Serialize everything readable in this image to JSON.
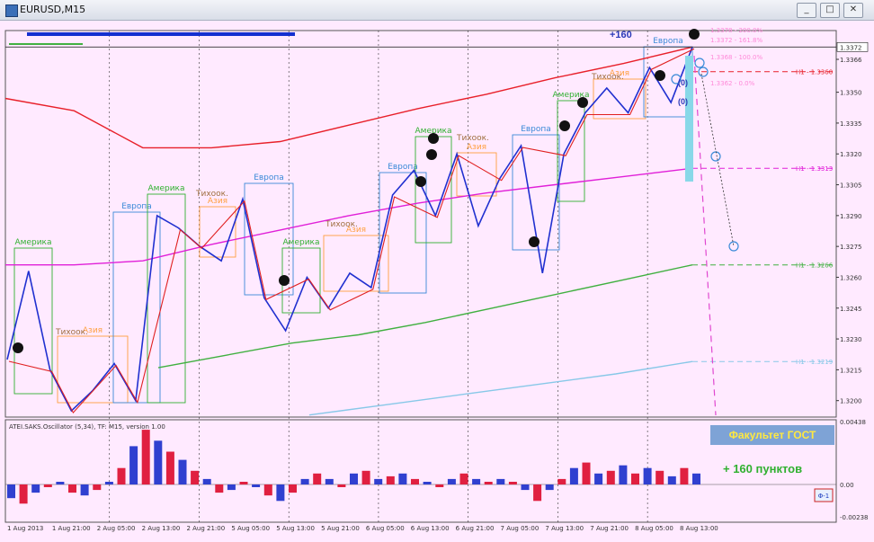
{
  "window": {
    "title": "EURUSD,M15",
    "buttons": [
      "_",
      "□",
      "✕"
    ]
  },
  "chart_data": {
    "type": "line",
    "symbol": "EURUSD",
    "timeframe": "M15",
    "price_axis": {
      "ticks": [
        "1.3366",
        "1.3350",
        "1.3335",
        "1.3320",
        "1.3305",
        "1.3290",
        "1.3275",
        "1.3260",
        "1.3245",
        "1.3230",
        "1.3215",
        "1.3200"
      ],
      "current_price": "1.3372",
      "ylim": [
        1.3192,
        1.338
      ]
    },
    "time_axis": {
      "ticks": [
        "1 Aug 2013",
        "1 Aug 21:00",
        "2 Aug 05:00",
        "2 Aug 13:00",
        "2 Aug 21:00",
        "5 Aug 05:00",
        "5 Aug 13:00",
        "5 Aug 21:00",
        "6 Aug 05:00",
        "6 Aug 13:00",
        "6 Aug 21:00",
        "7 Aug 05:00",
        "7 Aug 13:00",
        "7 Aug 21:00",
        "8 Aug 05:00",
        "8 Aug 13:00"
      ]
    },
    "series": [
      {
        "name": "",
        "color": "#e8202a",
        "values": [
          1.3347,
          1.3341,
          1.3323,
          1.3323,
          1.3326,
          1.3334,
          1.3342,
          1.3349,
          1.3357,
          1.3364,
          1.3372
        ]
      },
      {
        "name": "",
        "color": "#e020d8",
        "values": [
          1.3266,
          1.3266,
          1.3268,
          1.3276,
          1.3283,
          1.329,
          1.3296,
          1.3301,
          1.3305,
          1.3309,
          1.3313
        ]
      },
      {
        "name": "",
        "color": "#40b040",
        "values": [
          1.3216,
          1.3222,
          1.3228,
          1.3232,
          1.3238,
          1.3245,
          1.3252,
          1.3259,
          1.3266
        ]
      },
      {
        "name": "",
        "color": "#88c8e8",
        "values": [
          1.3193,
          1.3198,
          1.3203,
          1.3208,
          1.3213,
          1.3219
        ]
      },
      {
        "name": "",
        "color": "#2030d0",
        "values": [
          1.322,
          1.3263,
          1.3215,
          1.3195,
          1.3205,
          1.3218,
          1.32,
          1.329,
          1.3284,
          1.3275,
          1.3268,
          1.3298,
          1.325,
          1.3234,
          1.326,
          1.3245,
          1.3262,
          1.3255,
          1.33,
          1.3312,
          1.329,
          1.332,
          1.3285,
          1.3308,
          1.3324,
          1.3262,
          1.332,
          1.334,
          1.3352,
          1.334,
          1.3362,
          1.3345,
          1.3372
        ]
      }
    ],
    "levels": [
      {
        "label": "H1 - 1.3360",
        "value": 1.336,
        "color": "#e8202a"
      },
      {
        "label": "H1 - 1.3313",
        "value": 1.3313,
        "color": "#e020d8"
      },
      {
        "label": "H1 - 1.3266",
        "value": 1.3266,
        "color": "#40b040"
      },
      {
        "label": "H1 - 1.3219",
        "value": 1.3219,
        "color": "#88c8e8"
      }
    ],
    "fibo": [
      "1.3378 - 200.0%",
      "1.3372 - 161.8%",
      "1.3368 - 100.0%",
      "1.3362 - 0.0%"
    ],
    "sessions": {
      "europe": "Европа",
      "america": "Америка",
      "asia": "Азия",
      "pacific": "Тихоок."
    },
    "annotations": {
      "profit_top": "+160",
      "zero_label": "(0)",
      "faculty": "Факультет ГОСТ",
      "profit_text": "+ 160 пунктов"
    },
    "oscillator": {
      "title": "ATEI.SAKS.Oscillator (5,34),  TF: M15,  version 1.00",
      "ticks": [
        "0.00438",
        "0.00",
        "-0.00238"
      ],
      "button": "Φ-1",
      "values": [
        -0.001,
        -0.0014,
        -0.0006,
        -0.0002,
        0.0002,
        -0.0006,
        -0.0008,
        -0.0004,
        0.0002,
        0.0012,
        0.0028,
        0.004,
        0.0032,
        0.0024,
        0.0018,
        0.001,
        0.0004,
        -0.0006,
        -0.0004,
        0.0002,
        -0.0002,
        -0.0008,
        -0.0012,
        -0.0006,
        0.0004,
        0.0008,
        0.0004,
        -0.0002,
        0.0008,
        0.001,
        0.0004,
        0.0006,
        0.0008,
        0.0004,
        0.0002,
        -0.0002,
        0.0004,
        0.0008,
        0.0004,
        0.0002,
        0.0004,
        0.0002,
        -0.0004,
        -0.0012,
        -0.0004,
        0.0004,
        0.0012,
        0.0016,
        0.0008,
        0.001,
        0.0014,
        0.0008,
        0.0012,
        0.001,
        0.0006,
        0.0012,
        0.0008
      ]
    }
  }
}
